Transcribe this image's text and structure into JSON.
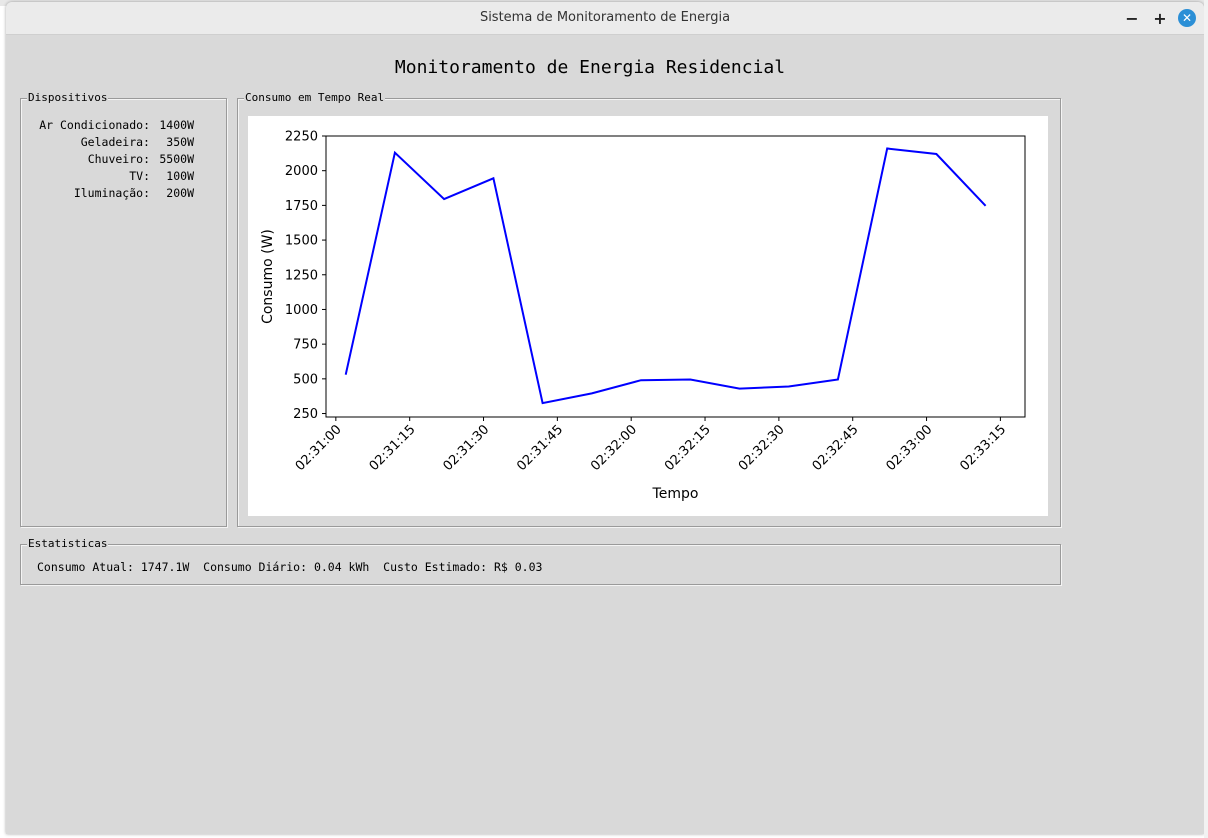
{
  "window": {
    "title": "Sistema de Monitoramento de Energia",
    "minimize": "−",
    "maximize": "+",
    "close": "✕"
  },
  "app": {
    "title": "Monitoramento de Energia Residencial"
  },
  "devices": {
    "label": "Dispositivos",
    "items": [
      {
        "name": "Ar Condicionado:",
        "power": "1400W"
      },
      {
        "name": "Geladeira:",
        "power": "350W"
      },
      {
        "name": "Chuveiro:",
        "power": "5500W"
      },
      {
        "name": "TV:",
        "power": "100W"
      },
      {
        "name": "Iluminação:",
        "power": "200W"
      }
    ]
  },
  "chart_panel": {
    "label": "Consumo em Tempo Real"
  },
  "chart_data": {
    "type": "line",
    "xlabel": "Tempo",
    "ylabel": "Consumo (W)",
    "x": [
      "02:31:02",
      "02:31:12",
      "02:31:22",
      "02:31:32",
      "02:31:42",
      "02:31:52",
      "02:32:02",
      "02:32:12",
      "02:32:22",
      "02:32:32",
      "02:32:42",
      "02:32:52",
      "02:33:02",
      "02:33:12"
    ],
    "series": [
      {
        "values": [
          530,
          2130,
          1795,
          1945,
          325,
          395,
          490,
          495,
          430,
          445,
          495,
          2160,
          2120,
          1747
        ]
      }
    ],
    "xticks": [
      "02:31:00",
      "02:31:15",
      "02:31:30",
      "02:31:45",
      "02:32:00",
      "02:32:15",
      "02:32:30",
      "02:32:45",
      "02:33:00",
      "02:33:15"
    ],
    "yticks": [
      250,
      500,
      750,
      1000,
      1250,
      1500,
      1750,
      2000,
      2250
    ],
    "ylim": [
      225,
      2250
    ],
    "xlim": [
      "02:30:58",
      "02:33:20"
    ],
    "line_color": "#0000ff",
    "grid": false
  },
  "stats": {
    "label": "Estatisticas",
    "text": "Consumo Atual: 1747.1W  Consumo Diário: 0.04 kWh  Custo Estimado: R$ 0.03"
  }
}
